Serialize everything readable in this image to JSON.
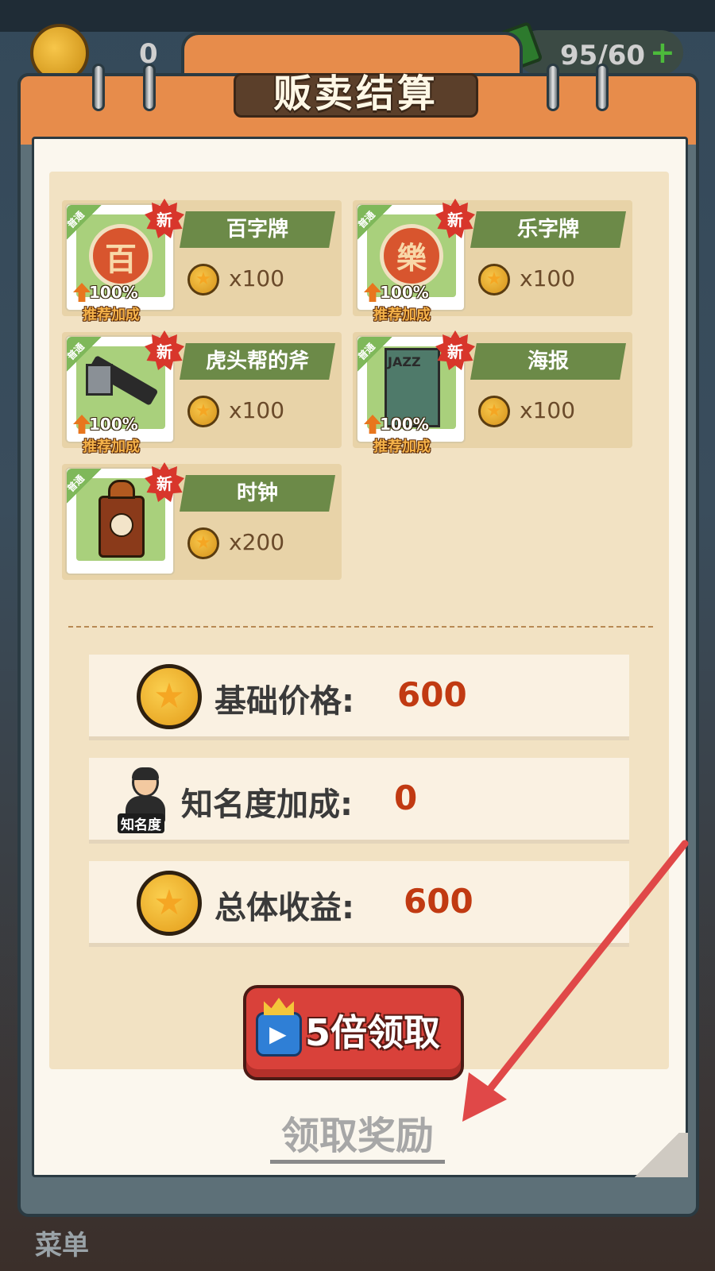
{
  "hud": {
    "coins": "0",
    "energy": "95/60",
    "energy_add_icon": "plus-icon"
  },
  "title": "贩卖结算",
  "items": [
    {
      "name": "百字牌",
      "quantity": "x100",
      "rarity": "普通",
      "new_badge": "新",
      "bonus_pct": "100%",
      "bonus_label": "推荐加成",
      "icon": "plaque-bai-icon",
      "glyph": "百"
    },
    {
      "name": "乐字牌",
      "quantity": "x100",
      "rarity": "普通",
      "new_badge": "新",
      "bonus_pct": "100%",
      "bonus_label": "推荐加成",
      "icon": "plaque-le-icon",
      "glyph": "樂"
    },
    {
      "name": "虎头帮的斧",
      "quantity": "x100",
      "rarity": "普通",
      "new_badge": "新",
      "bonus_pct": "100%",
      "bonus_label": "推荐加成",
      "icon": "axe-icon"
    },
    {
      "name": "海报",
      "quantity": "x100",
      "rarity": "普通",
      "new_badge": "新",
      "bonus_pct": "100%",
      "bonus_label": "推荐加成",
      "icon": "poster-icon",
      "poster_text": "JAZZ"
    },
    {
      "name": "时钟",
      "quantity": "x200",
      "rarity": "普通",
      "new_badge": "新",
      "icon": "clock-icon"
    }
  ],
  "summary": {
    "base_price_label": "基础价格:",
    "base_price_value": "600",
    "fame_bonus_label": "知名度加成:",
    "fame_bonus_value": "0",
    "fame_tag": "知名度",
    "total_label": "总体收益:",
    "total_value": "600"
  },
  "buttons": {
    "claim_5x": "5倍领取",
    "claim": "领取奖励"
  },
  "menu_label": "菜单",
  "colors": {
    "accent_red": "#d9413a",
    "value_red": "#c13a12",
    "panel_orange": "#e78c4b",
    "name_bar_green": "#6c8a48",
    "annotation_arrow": "#e04848"
  }
}
